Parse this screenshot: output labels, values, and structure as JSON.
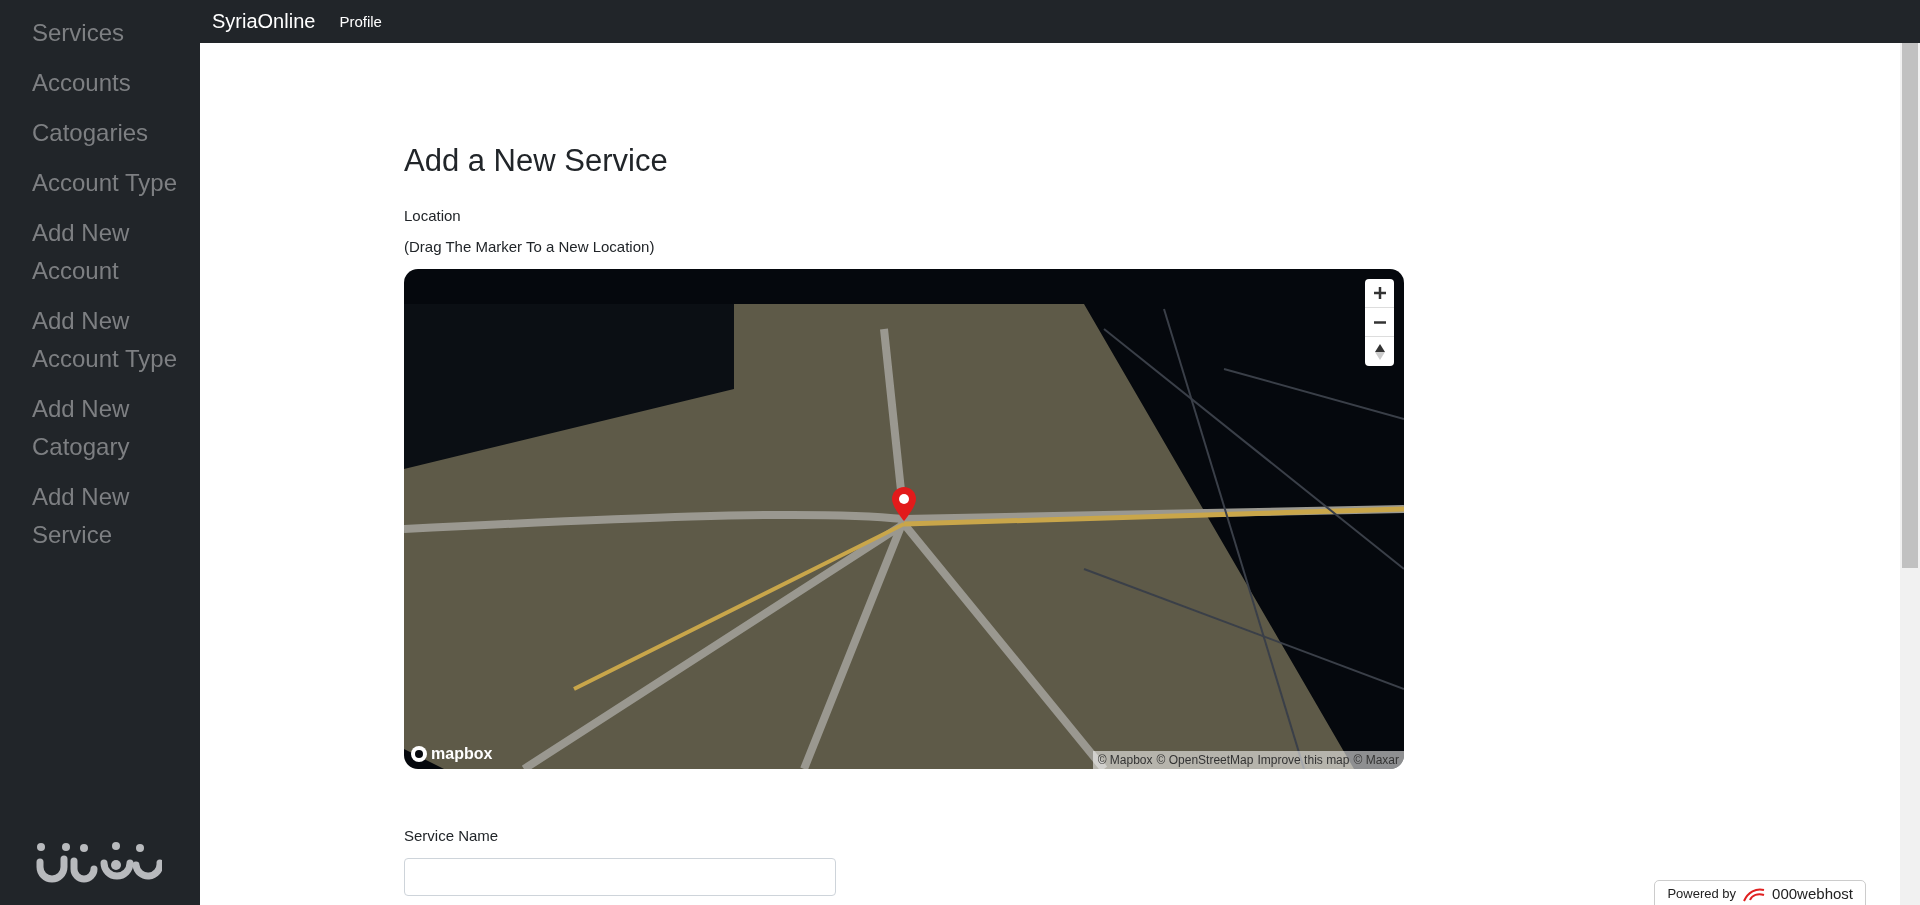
{
  "sidebar": {
    "items": [
      {
        "label": "Services"
      },
      {
        "label": "Accounts"
      },
      {
        "label": "Catogaries"
      },
      {
        "label": "Account Type"
      },
      {
        "label": "Add New Account"
      },
      {
        "label": "Add New Account Type"
      },
      {
        "label": "Add New Catogary"
      },
      {
        "label": "Add New Service"
      }
    ]
  },
  "navbar": {
    "brand": "SyriaOnline",
    "links": [
      "Profile"
    ]
  },
  "form": {
    "title": "Add a New Service",
    "location_label": "Location",
    "location_hint": "(Drag The Marker To a New Location)",
    "map": {
      "logo": "mapbox",
      "attribution": [
        "© Mapbox",
        "© OpenStreetMap",
        "Improve this map",
        "© Maxar"
      ]
    },
    "service_name_label": "Service Name"
  },
  "badge": {
    "prefix": "Powered by",
    "brand": "000webhost"
  }
}
